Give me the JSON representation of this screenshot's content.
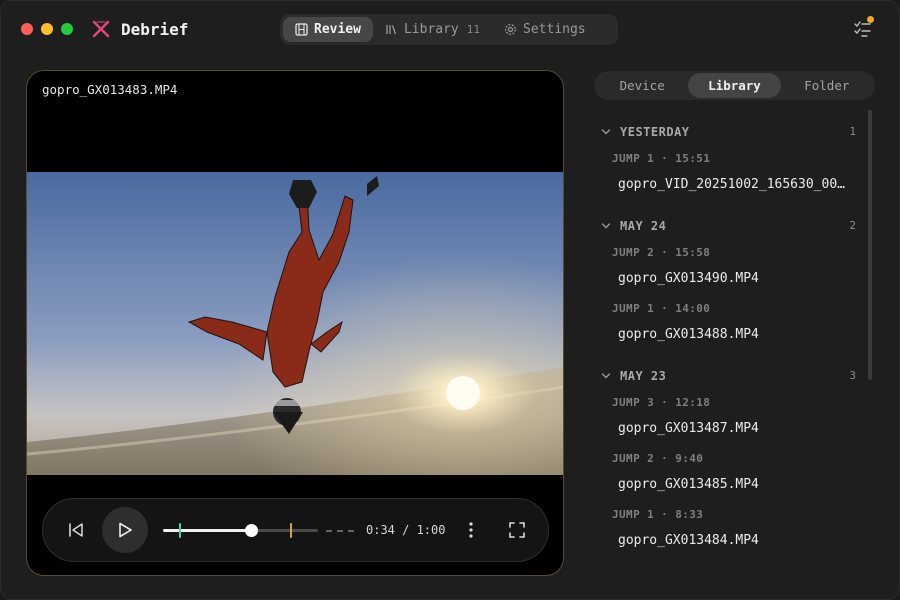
{
  "app": {
    "name": "Debrief"
  },
  "nav": {
    "items": [
      {
        "label": "Review",
        "icon": "film-icon",
        "active": true
      },
      {
        "label": "Library",
        "icon": "library-icon",
        "count": "11",
        "active": false
      },
      {
        "label": "Settings",
        "icon": "gear-icon",
        "active": false
      }
    ]
  },
  "player": {
    "filename": "gopro_GX013483.MP4",
    "time": "0:34 / 1:00",
    "progress": 0.567,
    "trim_start": 0.1,
    "trim_end": 0.82
  },
  "source_tabs": [
    {
      "label": "Device",
      "active": false
    },
    {
      "label": "Library",
      "active": true
    },
    {
      "label": "Folder",
      "active": false
    }
  ],
  "groups": [
    {
      "title": "YESTERDAY",
      "count": "1",
      "jumps": [
        {
          "meta": "JUMP 1 · 15:51",
          "file": "gopro_VID_20251002_165630_00…"
        }
      ]
    },
    {
      "title": "MAY 24",
      "count": "2",
      "jumps": [
        {
          "meta": "JUMP 2 · 15:58",
          "file": "gopro_GX013490.MP4"
        },
        {
          "meta": "JUMP 1 · 14:00",
          "file": "gopro_GX013488.MP4"
        }
      ]
    },
    {
      "title": "MAY 23",
      "count": "3",
      "jumps": [
        {
          "meta": "JUMP 3 · 12:18",
          "file": "gopro_GX013487.MP4"
        },
        {
          "meta": "JUMP 2 · 9:40",
          "file": "gopro_GX013485.MP4"
        },
        {
          "meta": "JUMP 1 · 8:33",
          "file": "gopro_GX013484.MP4"
        }
      ]
    }
  ],
  "colors": {
    "accent_trim_start": "#4fd1a5",
    "accent_trim_end": "#d9a23f",
    "notification_dot": "#f5a623"
  }
}
